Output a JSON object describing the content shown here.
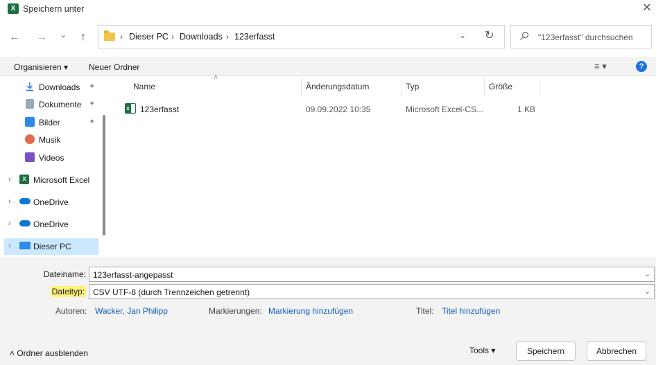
{
  "window": {
    "title": "Speichern unter",
    "app_icon_letter": "X",
    "close_glyph": "✕"
  },
  "nav_buttons": {
    "back": "←",
    "forward": "→",
    "recent": "⌄",
    "up": "↑"
  },
  "address": {
    "crumbs": [
      "Dieser PC",
      "Downloads",
      "123erfasst"
    ],
    "sep": "›",
    "dropdown": "⌄",
    "refresh": "↻"
  },
  "search": {
    "placeholder": "\"123erfasst\" durchsuchen"
  },
  "toolbar": {
    "organize": "Organisieren ▾",
    "new_folder": "Neuer Ordner",
    "view": "≡ ▾",
    "help": "?"
  },
  "nav": {
    "quick": [
      {
        "label": "Downloads",
        "icon": "download-icon",
        "pinned": true
      },
      {
        "label": "Dokumente",
        "icon": "documents-icon",
        "pinned": true
      },
      {
        "label": "Bilder",
        "icon": "pictures-icon",
        "pinned": true
      },
      {
        "label": "Musik",
        "icon": "music-icon",
        "pinned": false
      },
      {
        "label": "Videos",
        "icon": "videos-icon",
        "pinned": false
      }
    ],
    "pin_glyph": "📌",
    "chevron": "›",
    "roots": [
      {
        "label": "Microsoft Excel",
        "icon": "excel-icon"
      },
      {
        "label": "OneDrive",
        "icon": "onedrive-icon"
      },
      {
        "label": "OneDrive",
        "icon": "onedrive-icon"
      },
      {
        "label": "Dieser PC",
        "icon": "this-pc-icon",
        "selected": true
      }
    ]
  },
  "list": {
    "sort_arrow": "˄",
    "columns": [
      "Name",
      "Änderungsdatum",
      "Typ",
      "Größe"
    ],
    "rows": [
      {
        "name": "123erfasst",
        "date": "09.09.2022 10:35",
        "type": "Microsoft Excel-CS...",
        "size": "1 KB"
      }
    ]
  },
  "form": {
    "filename_label": "Dateiname:",
    "filename_value": "123erfasst-angepasst",
    "filetype_label": "Dateityp:",
    "filetype_value": "CSV UTF-8 (durch Trennzeichen getrennt)",
    "dropdown_glyph": "⌄",
    "authors_label": "Autoren:",
    "authors_value": "Wacker, Jan Philipp",
    "tags_label": "Markierungen:",
    "tags_value": "Markierung hinzufügen",
    "title_label": "Titel:",
    "title_value": "Titel hinzufügen"
  },
  "footer": {
    "hide_folders": "˄  Ordner ausblenden",
    "tools": "Tools  ▾",
    "save": "Speichern",
    "cancel": "Abbrechen"
  },
  "colors": {
    "accent": "#1a73e8",
    "excel_green": "#1d6f42",
    "selection": "#cce8ff",
    "highlight": "#fff27a",
    "link": "#0a5bbd"
  }
}
